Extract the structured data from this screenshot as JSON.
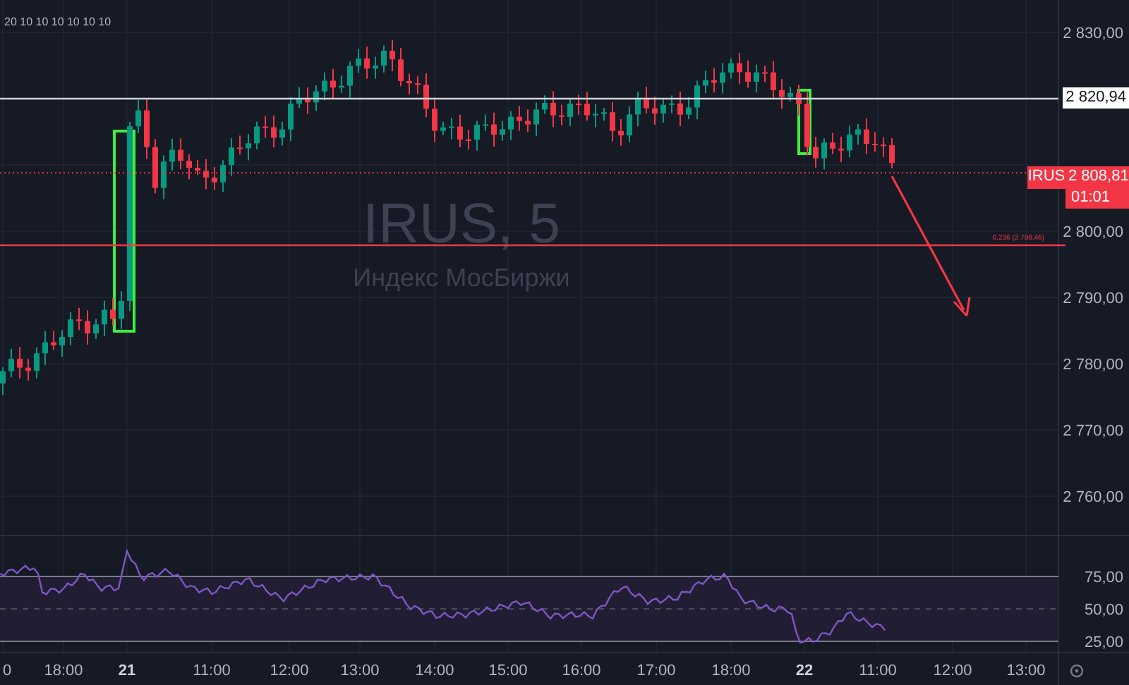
{
  "header": {
    "indicator_values": "20 10 10 10 10 10 10"
  },
  "watermark": {
    "symbol": "IRUS, 5",
    "name": "Индекс МосБиржи"
  },
  "fib_level": {
    "label": "0,236 (2 798,46)"
  },
  "price_axis": {
    "ticks": [
      "2 830,00",
      "2 800,00",
      "2 790,00",
      "2 780,00",
      "2 770,00",
      "2 760,00"
    ],
    "line_label": "2 820,94",
    "last_price": {
      "symbol": "IRUS",
      "price": "2 808,81",
      "countdown": "01:01"
    }
  },
  "rsi": {
    "ticks": [
      "75,00",
      "50,00",
      "25,00"
    ]
  },
  "time_axis": {
    "labels": [
      {
        "text": "0",
        "bold": false
      },
      {
        "text": "18:00",
        "bold": false
      },
      {
        "text": "21",
        "bold": true
      },
      {
        "text": "11:00",
        "bold": false
      },
      {
        "text": "12:00",
        "bold": false
      },
      {
        "text": "13:00",
        "bold": false
      },
      {
        "text": "14:00",
        "bold": false
      },
      {
        "text": "15:00",
        "bold": false
      },
      {
        "text": "16:00",
        "bold": false
      },
      {
        "text": "17:00",
        "bold": false
      },
      {
        "text": "18:00",
        "bold": false
      },
      {
        "text": "22",
        "bold": true
      },
      {
        "text": "11:00",
        "bold": false
      },
      {
        "text": "12:00",
        "bold": false
      },
      {
        "text": "13:00",
        "bold": false
      }
    ]
  }
}
